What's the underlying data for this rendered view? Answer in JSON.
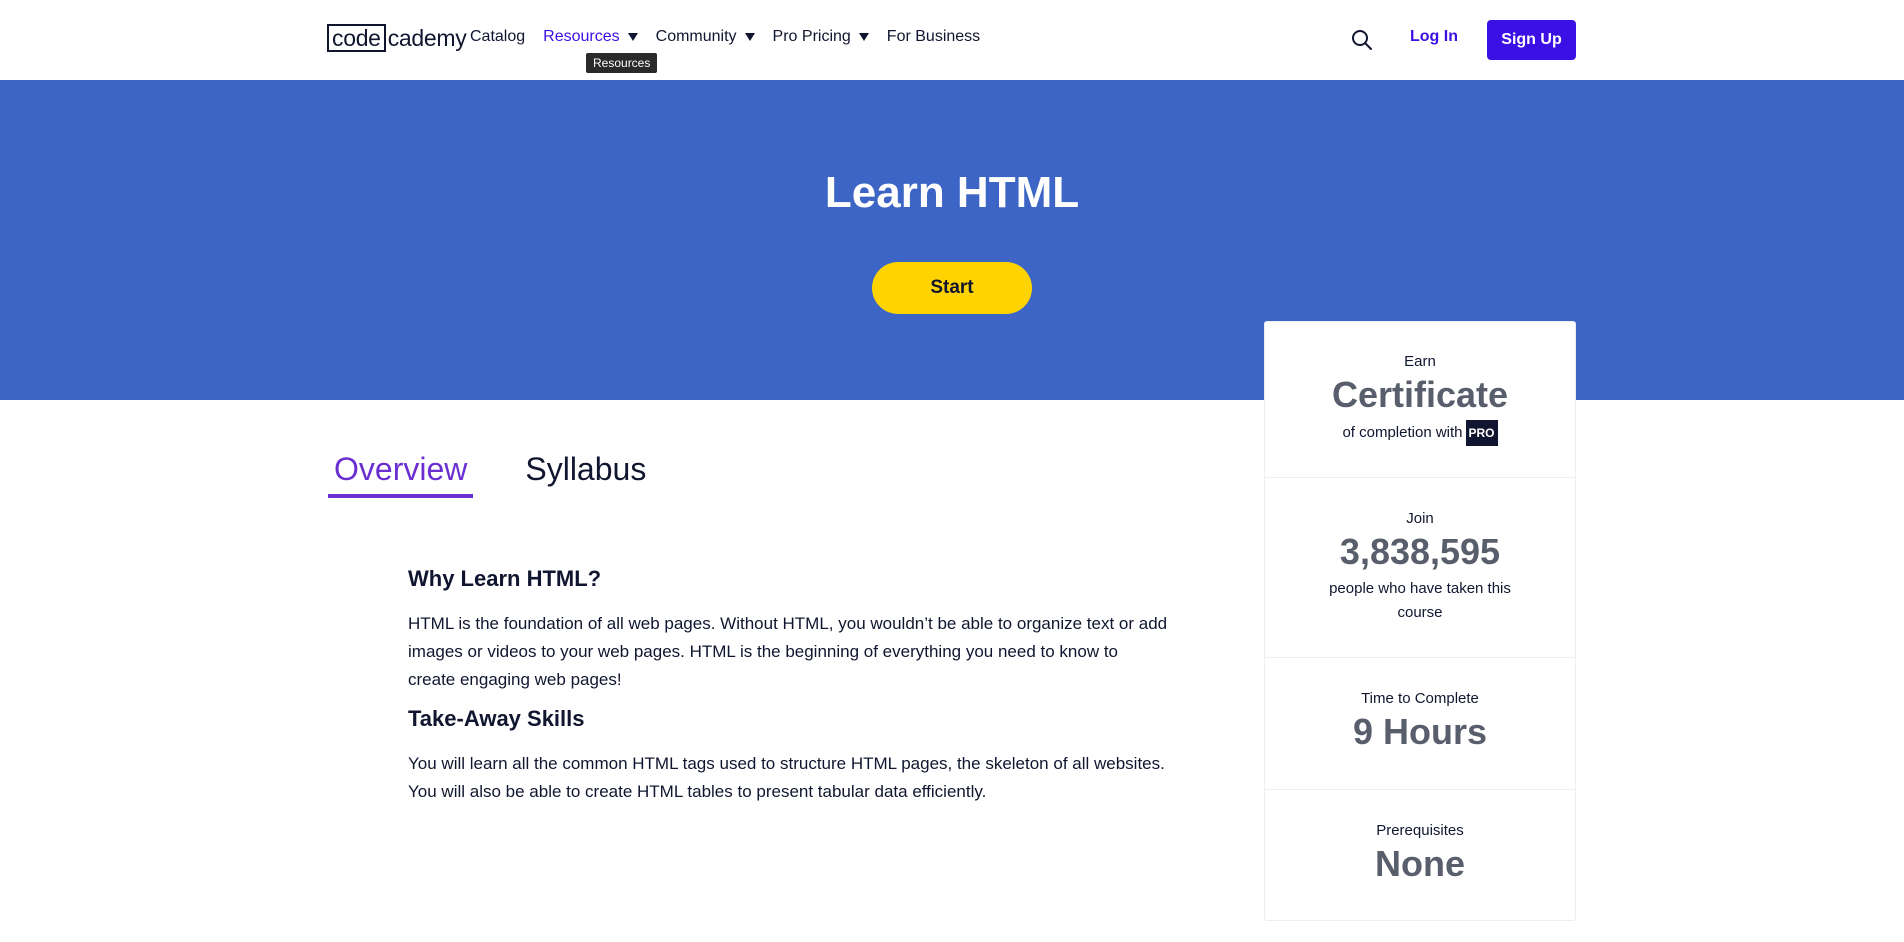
{
  "brand": {
    "logo_code": "code",
    "logo_cademy": "cademy"
  },
  "nav": {
    "items": [
      {
        "label": "Catalog"
      },
      {
        "label": "Resources"
      },
      {
        "label": "Community"
      },
      {
        "label": "Pro Pricing"
      },
      {
        "label": "For Business"
      }
    ],
    "tooltip": "Resources"
  },
  "header": {
    "search_icon": "search-icon",
    "login_label": "Log In",
    "signup_label": "Sign Up"
  },
  "hero": {
    "title": "Learn HTML",
    "start_label": "Start"
  },
  "tabs": [
    {
      "label": "Overview"
    },
    {
      "label": "Syllabus"
    }
  ],
  "content": {
    "section1_title": "Why Learn HTML?",
    "section1_body": "HTML is the foundation of all web pages. Without HTML, you wouldn’t be able to organize text or add images or videos to your web pages. HTML is the beginning of everything you need to know to create engaging web pages!",
    "section2_title": "Take-Away Skills",
    "section2_body": "You will learn all the common HTML tags used to structure HTML pages, the skeleton of all websites. You will also be able to create HTML tables to present tabular data efficiently."
  },
  "card": {
    "earn_label": "Earn",
    "earn_value": "Certificate",
    "earn_desc": "of completion with",
    "pro_badge": "PRO",
    "join_label": "Join",
    "join_value": "3,838,595",
    "join_desc": "people who have taken this course",
    "time_label": "Time to Complete",
    "time_value": "9 Hours",
    "prereq_label": "Prerequisites",
    "prereq_value": "None"
  },
  "colors": {
    "brand_accent": "#3a10e5",
    "hero_bg": "#3d65c5",
    "start_button": "#ffd300",
    "tab_active": "#6b2fd1"
  }
}
